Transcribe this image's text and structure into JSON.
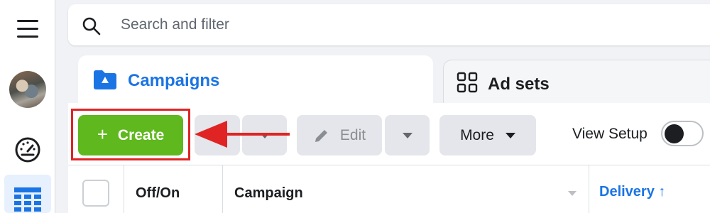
{
  "search": {
    "placeholder": "Search and filter"
  },
  "tabs": [
    {
      "label": "Campaigns",
      "active": true
    },
    {
      "label": "Ad sets",
      "active": false
    }
  ],
  "toolbar": {
    "create_label": "Create",
    "edit_label": "Edit",
    "more_label": "More",
    "view_setup_label": "View Setup",
    "view_setup_enabled": false
  },
  "table": {
    "columns": [
      "Off/On",
      "Campaign",
      "Delivery ↑"
    ]
  },
  "colors": {
    "accent": "#1b74e4",
    "create_green": "#5fb81e",
    "highlight_red": "#e02424"
  },
  "icons": [
    "menu-icon",
    "search-icon",
    "folder-flag-icon",
    "grid-icon",
    "plus-icon",
    "pencil-icon",
    "caret-down-icon",
    "gauge-icon",
    "table-icon"
  ]
}
